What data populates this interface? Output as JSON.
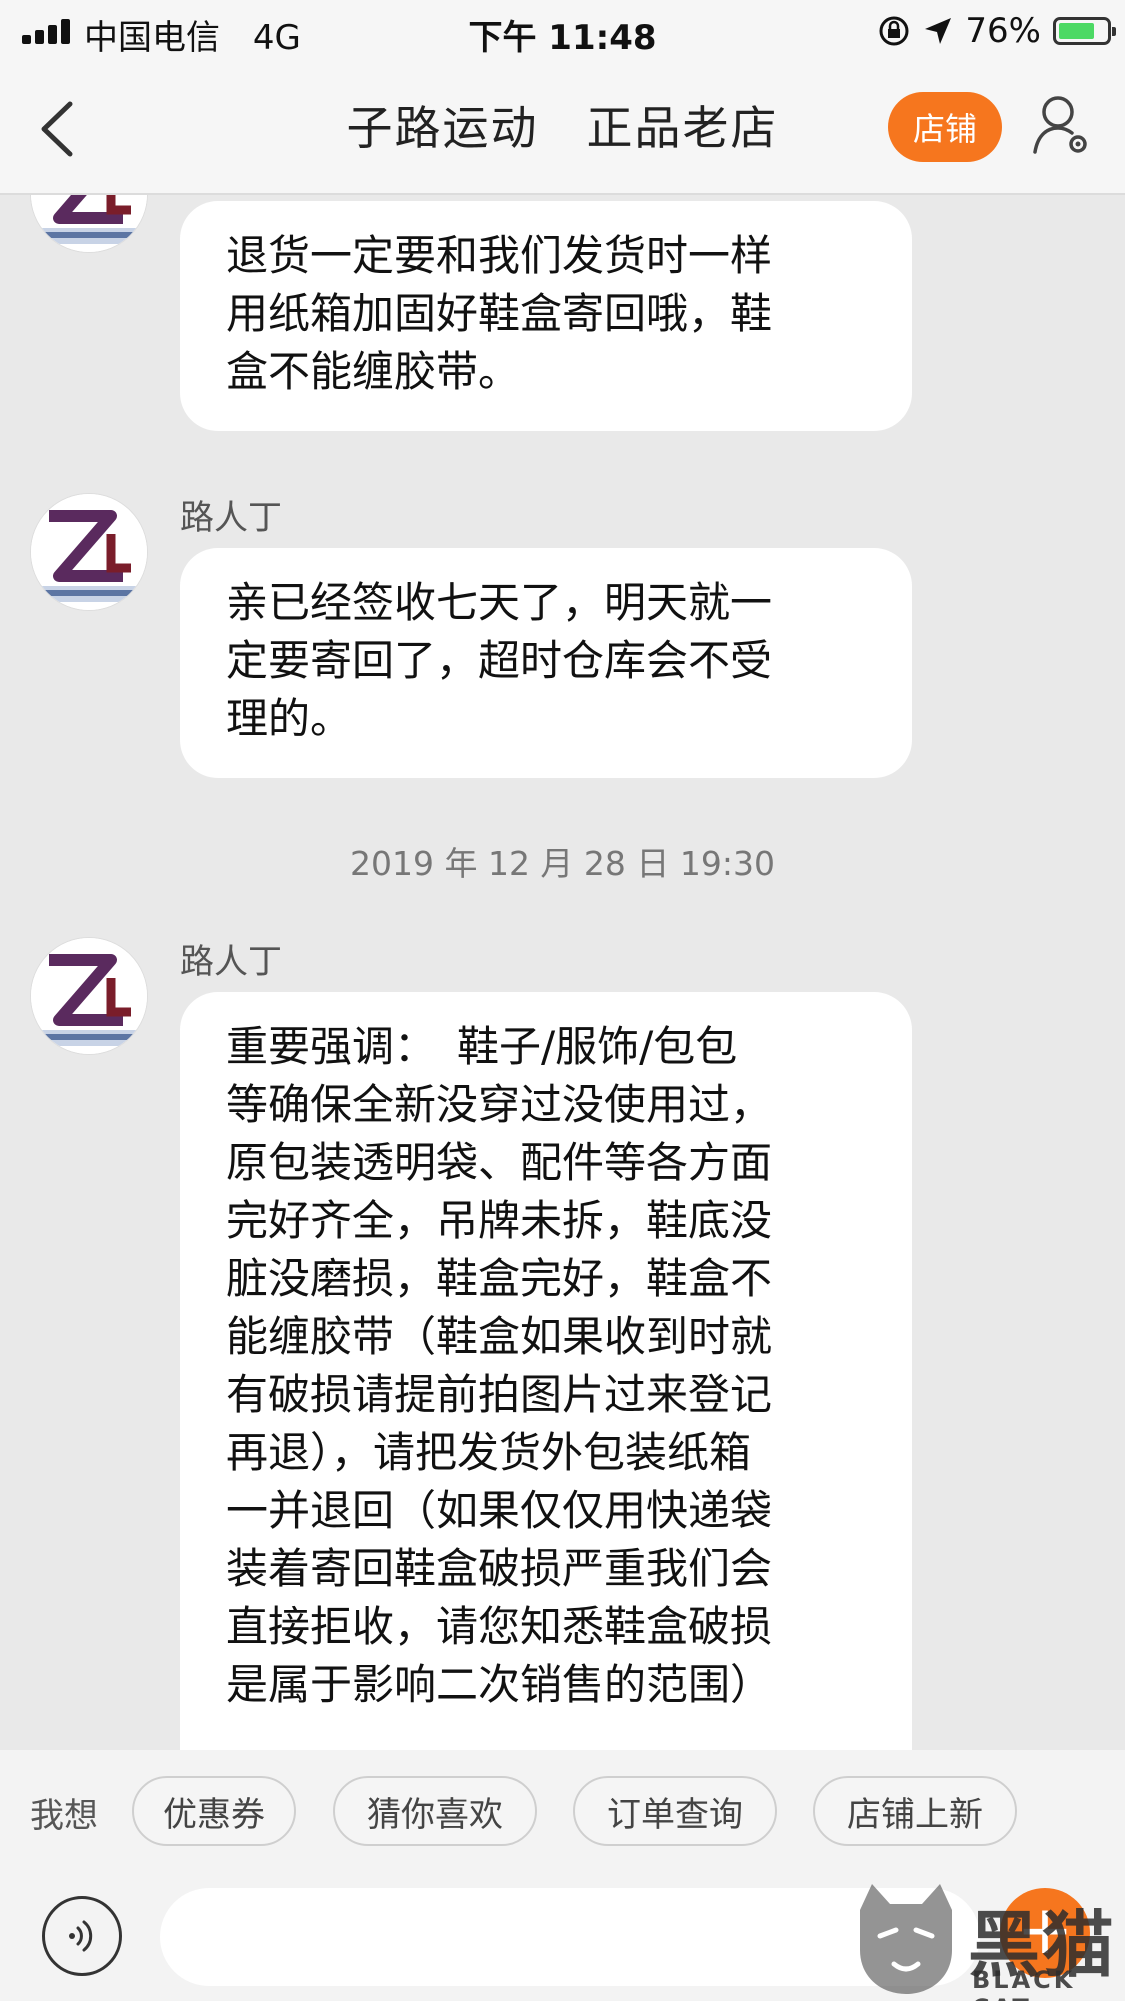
{
  "status_bar": {
    "carrier": "中国电信",
    "network": "4G",
    "time": "下午 11:48",
    "battery": "76%",
    "battery_level": 0.76
  },
  "nav": {
    "title": "子路运动　正品老店",
    "shop_button": "店铺",
    "icons": [
      "back-icon",
      "user-settings-icon"
    ]
  },
  "messages": [
    {
      "sender": "",
      "text": "退货一定要和我们发货时一样\n用纸箱加固好鞋盒寄回哦，鞋\n盒不能缠胶带。"
    },
    {
      "sender": "路人丁",
      "text": "亲已经签收七天了，明天就一\n定要寄回了，超时仓库会不受\n理的。"
    },
    {
      "sender": "路人丁",
      "text": "重要强调：　鞋子/服饰/包包\n等确保全新没穿过没使用过，\n原包装透明袋、配件等各方面\n完好齐全，吊牌未拆，鞋底没\n脏没磨损，鞋盒完好，鞋盒不\n能缠胶带（鞋盒如果收到时就\n有破损请提前拍图片过来登记\n再退），请把发货外包装纸箱\n一并退回（如果仅仅用快递袋\n装着寄回鞋盒破损严重我们会\n直接拒收，请您知悉鞋盒破损\n是属于影响二次销售的范围）"
    }
  ],
  "timestamp": "2019 年 12 月 28 日 19:30",
  "quick_replies": {
    "label": "我想",
    "items": [
      "优惠券",
      "猜你喜欢",
      "订单查询",
      "店铺上新"
    ]
  },
  "input": {
    "placeholder": "",
    "icons": [
      "voice-icon",
      "plus-icon"
    ]
  },
  "watermark": {
    "text": "黑猫",
    "sub": "BLACK CAT"
  },
  "colors": {
    "accent": "#f6761e",
    "background": "#e9e9e9",
    "bubble": "#ffffff"
  }
}
